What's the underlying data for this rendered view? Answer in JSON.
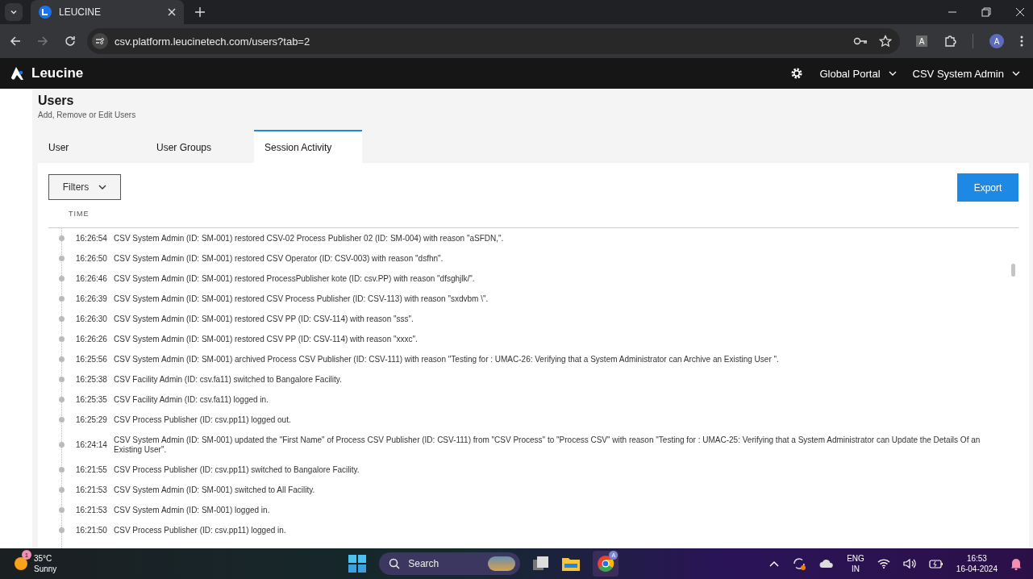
{
  "browser": {
    "tab_title": "LEUCINE",
    "url": "csv.platform.leucinetech.com/users?tab=2",
    "extension_label": "A",
    "profile_initial": "A"
  },
  "header": {
    "logo": "Leucine",
    "portal": "Global Portal",
    "user": "CSV System Admin"
  },
  "page": {
    "title": "Users",
    "subtitle": "Add, Remove or Edit Users",
    "tabs": [
      {
        "label": "User",
        "selected": false
      },
      {
        "label": "User Groups",
        "selected": false
      },
      {
        "label": "Session Activity",
        "selected": true
      }
    ],
    "filters_button": "Filters",
    "export_button": "Export",
    "column": "TIME",
    "entries": [
      {
        "time": "16:26:54",
        "text": "CSV System Admin (ID: SM-001) restored CSV-02 Process Publisher 02 (ID: SM-004) with reason \"aSFDN,\"."
      },
      {
        "time": "16:26:50",
        "text": "CSV System Admin (ID: SM-001) restored CSV Operator (ID: CSV-003) with reason \"dsfhn\"."
      },
      {
        "time": "16:26:46",
        "text": "CSV System Admin (ID: SM-001) restored ProcessPublisher kote (ID: csv.PP) with reason \"dfsghjlk/\"."
      },
      {
        "time": "16:26:39",
        "text": "CSV System Admin (ID: SM-001) restored CSV Process Publisher (ID: CSV-113) with reason \"sxdvbm \\\"."
      },
      {
        "time": "16:26:30",
        "text": "CSV System Admin (ID: SM-001) restored CSV PP (ID: CSV-114) with reason \"sss\"."
      },
      {
        "time": "16:26:26",
        "text": "CSV System Admin (ID: SM-001) restored CSV PP (ID: CSV-114) with reason \"xxxc\"."
      },
      {
        "time": "16:25:56",
        "text": "CSV System Admin (ID: SM-001) archived Process CSV Publisher (ID: CSV-111) with reason \"Testing for : UMAC-26: Verifying that a System Administrator can Archive an Existing User \"."
      },
      {
        "time": "16:25:38",
        "text": "CSV Facility Admin (ID: csv.fa11) switched to Bangalore Facility."
      },
      {
        "time": "16:25:35",
        "text": "CSV Facility Admin (ID: csv.fa11) logged in."
      },
      {
        "time": "16:25:29",
        "text": "CSV Process Publisher (ID: csv.pp11) logged out."
      },
      {
        "time": "16:24:14",
        "text": "CSV System Admin (ID: SM-001) updated the \"First Name\" of Process CSV Publisher (ID: CSV-111) from \"CSV Process\" to \"Process CSV\" with reason \"Testing for : UMAC-25: Verifying that a System Administrator can Update the Details Of an Existing User\"."
      },
      {
        "time": "16:21:55",
        "text": "CSV Process Publisher (ID: csv.pp11) switched to Bangalore Facility."
      },
      {
        "time": "16:21:53",
        "text": "CSV System Admin (ID: SM-001) switched to All Facility."
      },
      {
        "time": "16:21:53",
        "text": "CSV System Admin (ID: SM-001) logged in."
      },
      {
        "time": "16:21:50",
        "text": "CSV Process Publisher (ID: csv.pp11) logged in."
      }
    ]
  },
  "taskbar": {
    "weather_badge": "1",
    "temperature": "35°C",
    "condition": "Sunny",
    "search": "Search",
    "chrome_badge": "A",
    "language": "ENG",
    "region": "IN",
    "time": "16:53",
    "date": "16-04-2024"
  }
}
